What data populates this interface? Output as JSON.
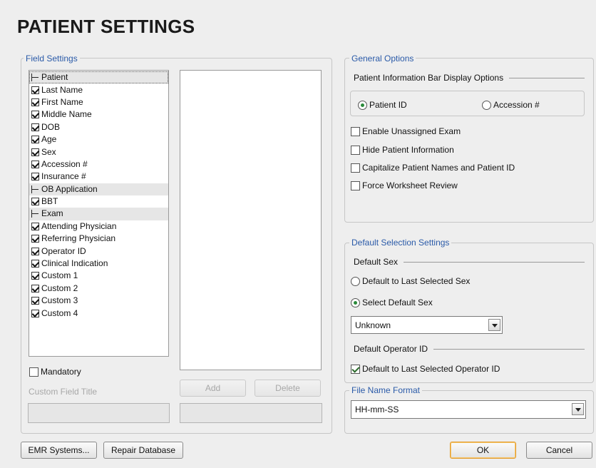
{
  "title": "PATIENT SETTINGS",
  "field_settings": {
    "legend": "Field Settings",
    "tree": [
      {
        "type": "group",
        "label": "Patient"
      },
      {
        "type": "item",
        "label": "Last Name",
        "checked": true
      },
      {
        "type": "item",
        "label": "First Name",
        "checked": true
      },
      {
        "type": "item",
        "label": "Middle Name",
        "checked": true
      },
      {
        "type": "item",
        "label": "DOB",
        "checked": true
      },
      {
        "type": "item",
        "label": "Age",
        "checked": true
      },
      {
        "type": "item",
        "label": "Sex",
        "checked": true
      },
      {
        "type": "item",
        "label": "Accession #",
        "checked": true
      },
      {
        "type": "item",
        "label": "Insurance #",
        "checked": true
      },
      {
        "type": "group",
        "label": "OB Application"
      },
      {
        "type": "item",
        "label": "BBT",
        "checked": true
      },
      {
        "type": "group",
        "label": "Exam"
      },
      {
        "type": "item",
        "label": "Attending Physician",
        "checked": true
      },
      {
        "type": "item",
        "label": "Referring Physician",
        "checked": true
      },
      {
        "type": "item",
        "label": "Operator ID",
        "checked": true
      },
      {
        "type": "item",
        "label": "Clinical Indication",
        "checked": true
      },
      {
        "type": "item",
        "label": "Custom 1",
        "checked": true
      },
      {
        "type": "item",
        "label": "Custom 2",
        "checked": true
      },
      {
        "type": "item",
        "label": "Custom 3",
        "checked": true
      },
      {
        "type": "item",
        "label": "Custom 4",
        "checked": true
      }
    ],
    "mandatory_label": "Mandatory",
    "custom_field_title_label": "Custom Field Title",
    "add_label": "Add",
    "delete_label": "Delete"
  },
  "general_options": {
    "legend": "General Options",
    "info_bar_label": "Patient Information Bar Display Options",
    "radio_patient_id": "Patient ID",
    "radio_accession": "Accession #",
    "enable_unassigned_exam": "Enable Unassigned Exam",
    "hide_patient_information": "Hide Patient Information",
    "capitalize_names": "Capitalize Patient Names and Patient ID",
    "force_worksheet_review": "Force Worksheet Review"
  },
  "default_selection": {
    "legend": "Default Selection Settings",
    "default_sex_label": "Default Sex",
    "radio_last_selected_sex": "Default to Last Selected Sex",
    "radio_select_default_sex": "Select Default Sex",
    "sex_value": "Unknown",
    "default_operator_label": "Default Operator ID",
    "default_last_operator": "Default to Last Selected Operator ID"
  },
  "file_name_format": {
    "legend": "File Name Format",
    "value": "HH-mm-SS"
  },
  "footer": {
    "emr_label": "EMR Systems...",
    "repair_label": "Repair Database",
    "ok_label": "OK",
    "cancel_label": "Cancel"
  }
}
